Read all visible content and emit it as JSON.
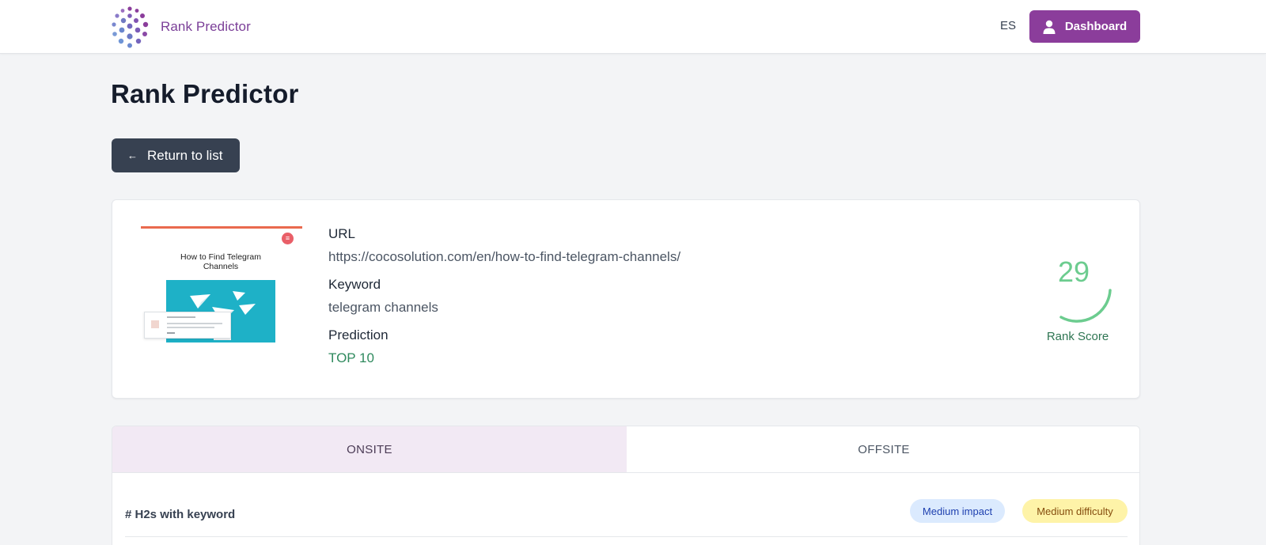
{
  "header": {
    "brand_name": "Rank Predictor",
    "language": "ES",
    "dashboard_label": "Dashboard",
    "brand_color": "#8b3d9b"
  },
  "page": {
    "title": "Rank Predictor",
    "return_label": "Return to list"
  },
  "result": {
    "thumbnail_title": "How to Find Telegram Channels",
    "url_label": "URL",
    "url_value": "https://cocosolution.com/en/how-to-find-telegram-channels/",
    "keyword_label": "Keyword",
    "keyword_value": "telegram channels",
    "prediction_label": "Prediction",
    "prediction_value": "TOP 10",
    "rank_score": "29",
    "rank_score_label": "Rank Score",
    "score_color": "#6ccc8f"
  },
  "tabs": [
    {
      "label": "ONSITE",
      "active": true
    },
    {
      "label": "OFFSITE",
      "active": false
    }
  ],
  "factors": [
    {
      "title": "# H2s with keyword",
      "impact": "Medium impact",
      "difficulty": "Medium difficulty"
    }
  ]
}
